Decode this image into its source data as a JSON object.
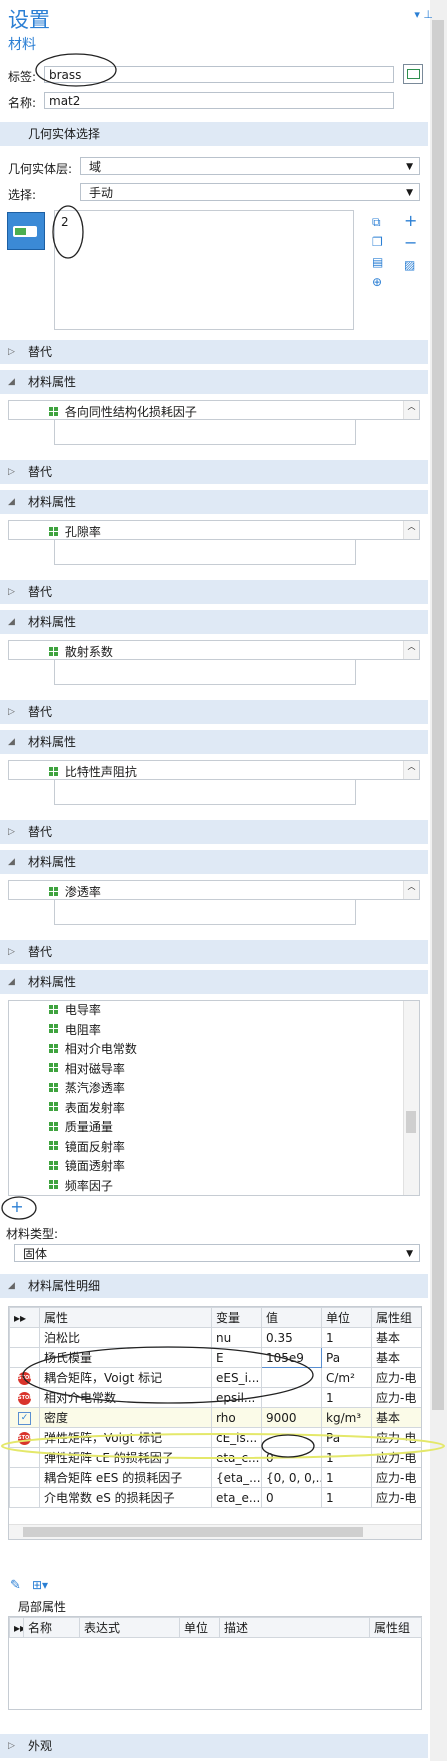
{
  "header": {
    "title": "设置",
    "subtitle": "材料",
    "pin": "▾ ⊥"
  },
  "fields": {
    "label_label": "标签:",
    "label_value": "brass",
    "name_label": "名称:",
    "name_value": "mat2"
  },
  "geom": {
    "section": "几何实体选择",
    "level_label": "几何实体层:",
    "level_value": "域",
    "select_label": "选择:",
    "select_value": "手动",
    "selected_entity": "2"
  },
  "groups": [
    {
      "override": "替代",
      "props": "材料属性",
      "item": "各向同性结构化损耗因子"
    },
    {
      "override": "替代",
      "props": "材料属性",
      "item": "孔隙率"
    },
    {
      "override": "替代",
      "props": "材料属性",
      "item": "散射系数"
    },
    {
      "override": "替代",
      "props": "材料属性",
      "item": "比特性声阻抗"
    },
    {
      "override": "替代",
      "props": "材料属性",
      "item": "渗透率"
    }
  ],
  "final": {
    "override": "替代",
    "props": "材料属性",
    "items": [
      "电导率",
      "电阻率",
      "相对介电常数",
      "相对磁导率",
      "蒸汽渗透率",
      "表面发射率",
      "质量通量",
      "镜面反射率",
      "镜面透射率",
      "频率因子"
    ]
  },
  "material_type": {
    "label": "材料类型:",
    "value": "固体"
  },
  "details": {
    "section": "材料属性明细",
    "headers": [
      "属性",
      "变量",
      "值",
      "单位",
      "属性组"
    ],
    "rows": [
      {
        "status": "",
        "prop": "泊松比",
        "var": "nu",
        "val": "0.35",
        "unit": "1",
        "group": "基本"
      },
      {
        "status": "",
        "prop": "杨氏模量",
        "var": "E",
        "val": "105e9",
        "unit": "Pa",
        "group": "基本"
      },
      {
        "status": "stop",
        "prop": "耦合矩阵，Voigt 标记",
        "var": "eES_i...",
        "val": "",
        "unit": "C/m²",
        "group": "应力-电"
      },
      {
        "status": "stop",
        "prop": "相对介电常数",
        "var": "epsil...",
        "val": "",
        "unit": "1",
        "group": "应力-电"
      },
      {
        "status": "check",
        "prop": "密度",
        "var": "rho",
        "val": "9000",
        "unit": "kg/m³",
        "group": "基本"
      },
      {
        "status": "stop",
        "prop": "弹性矩阵，Voigt 标记",
        "var": "cE_is...",
        "val": "",
        "unit": "Pa",
        "group": "应力-电"
      },
      {
        "status": "",
        "prop": "弹性矩阵 cE 的损耗因子",
        "var": "eta_c...",
        "val": "0",
        "unit": "1",
        "group": "应力-电"
      },
      {
        "status": "",
        "prop": "耦合矩阵 eES 的损耗因子",
        "var": "{eta_...",
        "val": "{0, 0, 0,...",
        "unit": "1",
        "group": "应力-电"
      },
      {
        "status": "",
        "prop": "介电常数 eS 的损耗因子",
        "var": "eta_e...",
        "val": "0",
        "unit": "1",
        "group": "应力-电"
      }
    ],
    "stop_text": "STOP"
  },
  "local": {
    "section": "局部属性",
    "headers": [
      "名称",
      "表达式",
      "单位",
      "描述",
      "属性组"
    ]
  },
  "footer": {
    "section": "外观"
  },
  "colors": {
    "accent": "#2b7fd4",
    "section_bg": "#dfe9f5",
    "stop": "#d9332b",
    "highlight": "#e4e86a"
  }
}
